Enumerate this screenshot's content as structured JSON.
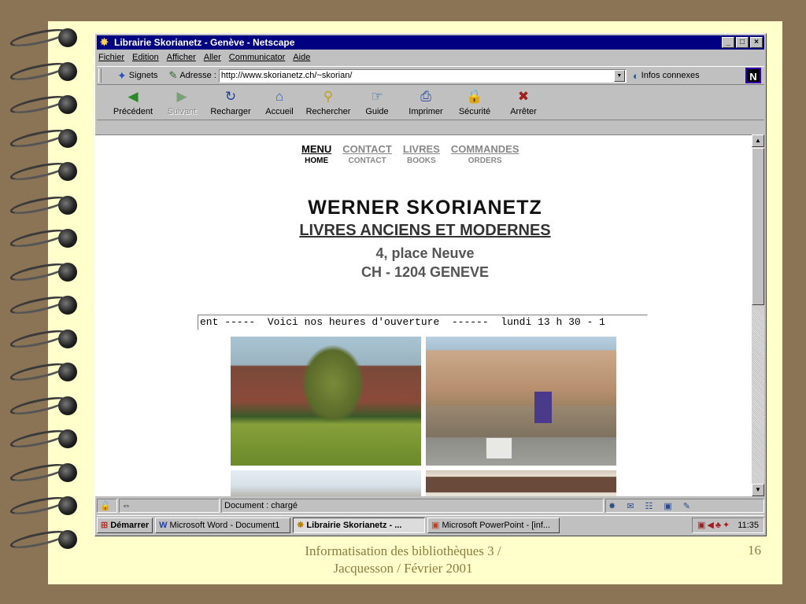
{
  "window": {
    "title": "Librairie Skorianetz - Genève - Netscape",
    "controls": [
      "_",
      "□",
      "×"
    ]
  },
  "menu": [
    "Fichier",
    "Edition",
    "Afficher",
    "Aller",
    "Communicator",
    "Aide"
  ],
  "location_bar": {
    "bookmarks_label": "Signets",
    "address_label": "Adresse :",
    "url": "http://www.skorianetz.ch/~skorian/",
    "related_label": "Infos connexes"
  },
  "toolbar": [
    {
      "label": "Précédent",
      "icon": "back-icon",
      "enabled": true
    },
    {
      "label": "Suivant",
      "icon": "forward-icon",
      "enabled": false
    },
    {
      "label": "Recharger",
      "icon": "reload-icon",
      "enabled": true
    },
    {
      "label": "Accueil",
      "icon": "home-icon",
      "enabled": true
    },
    {
      "label": "Rechercher",
      "icon": "search-icon",
      "enabled": true
    },
    {
      "label": "Guide",
      "icon": "guide-icon",
      "enabled": true
    },
    {
      "label": "Imprimer",
      "icon": "print-icon",
      "enabled": true
    },
    {
      "label": "Sécurité",
      "icon": "lock-icon",
      "enabled": true
    },
    {
      "label": "Arrêter",
      "icon": "stop-icon",
      "enabled": true
    }
  ],
  "site": {
    "nav": [
      {
        "top": "MENU",
        "bottom": "HOME",
        "active": true
      },
      {
        "top": "CONTACT",
        "bottom": "CONTACT",
        "active": false
      },
      {
        "top": "LIVRES",
        "bottom": "BOOKS",
        "active": false
      },
      {
        "top": "COMMANDES",
        "bottom": "ORDERS",
        "active": false
      }
    ],
    "name": "WERNER  SKORIANETZ",
    "subtitle": "LIVRES ANCIENS ET MODERNES",
    "address_line1": "4, place Neuve",
    "address_line2": "CH - 1204  GENEVE",
    "marquee": "ent -----  Voici nos heures d'ouverture  ------  lundi 13 h 30 - 1"
  },
  "status": {
    "text": "Document : chargé"
  },
  "taskbar": {
    "start": "Démarrer",
    "tasks": [
      {
        "label": "Microsoft Word - Document1",
        "active": false
      },
      {
        "label": "Librairie Skorianetz - ...",
        "active": true
      },
      {
        "label": "Microsoft PowerPoint - [inf...",
        "active": false
      }
    ],
    "clock": "11:35"
  },
  "slide": {
    "footer_line1": "Informatisation des bibliothèques 3 /",
    "footer_line2": "Jacquesson / Février 2001",
    "page_number": "16"
  }
}
